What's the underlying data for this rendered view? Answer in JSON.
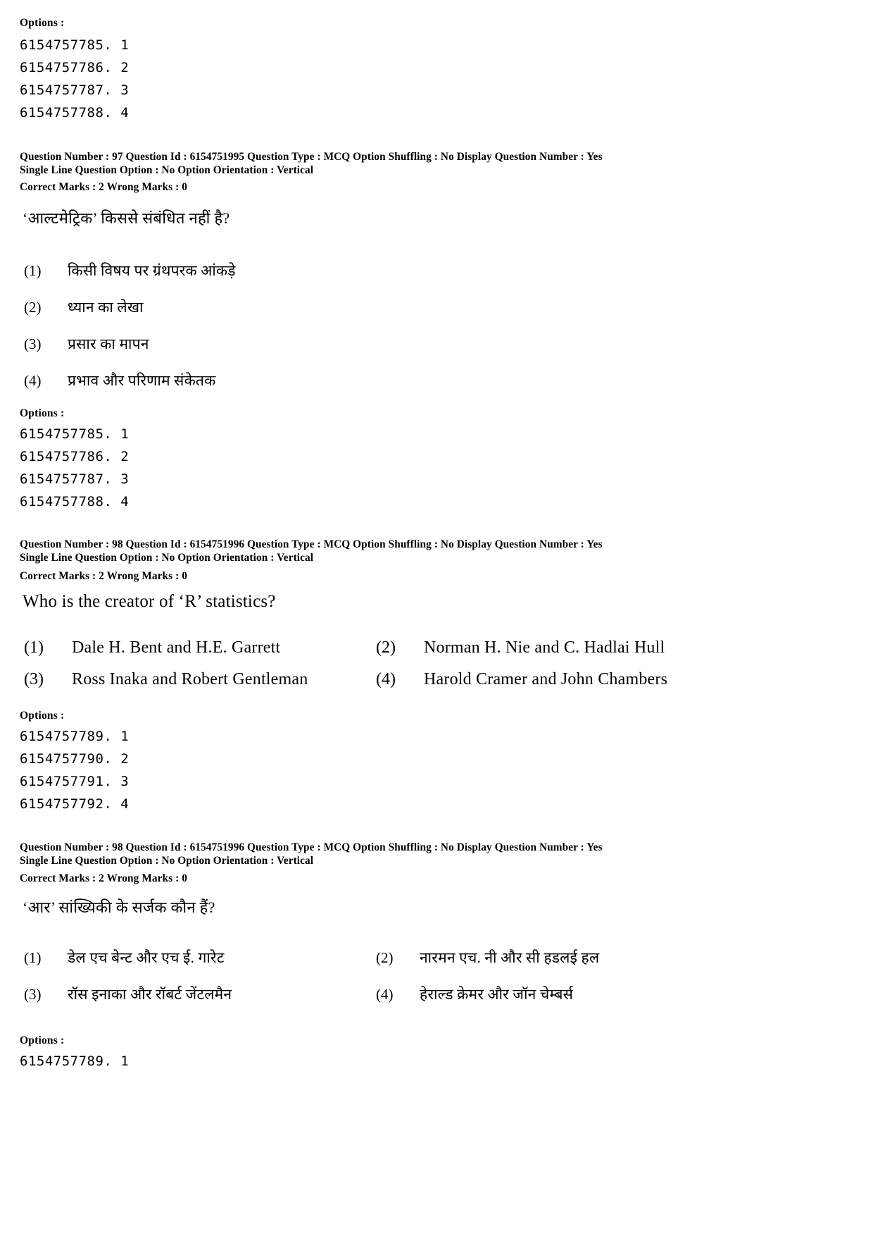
{
  "document": {
    "type": "exam-answer-key-sheet",
    "language_pairs": "English / Hindi"
  },
  "options_label": "Options :",
  "top_option_ids": [
    "6154757785. 1",
    "6154757786. 2",
    "6154757787. 3",
    "6154757788. 4"
  ],
  "questions": [
    {
      "id": "q97-hindi",
      "meta": {
        "line1": "Question Number : 97  Question Id : 6154751995  Question Type : MCQ  Option Shuffling : No  Display Question Number : Yes",
        "line2": "Single Line Question Option : No  Option Orientation : Vertical",
        "line3": "Correct Marks : 2  Wrong Marks : 0",
        "question_number": "97",
        "question_id": "6154751995",
        "question_type": "MCQ",
        "option_shuffling": "No",
        "display_question_number": "Yes",
        "single_line_question_option": "No",
        "option_orientation": "Vertical",
        "correct_marks": "2",
        "wrong_marks": "0"
      },
      "text": "‘आल्टमेट्रिक’ किससे संबंधित नहीं है?",
      "layout": "vertical",
      "options": [
        {
          "num": "(1)",
          "text": "किसी विषय पर ग्रंथपरक आंकड़े"
        },
        {
          "num": "(2)",
          "text": "ध्यान का लेखा"
        },
        {
          "num": "(3)",
          "text": "प्रसार का मापन"
        },
        {
          "num": "(4)",
          "text": "प्रभाव और परिणाम संकेतक"
        }
      ],
      "option_ids": [
        "6154757785. 1",
        "6154757786. 2",
        "6154757787. 3",
        "6154757788. 4"
      ]
    },
    {
      "id": "q98-english",
      "meta": {
        "line1": "Question Number : 98  Question Id : 6154751996  Question Type : MCQ  Option Shuffling : No  Display Question Number : Yes",
        "line2": "Single Line Question Option : No  Option Orientation : Vertical",
        "line3": "Correct Marks : 2  Wrong Marks : 0",
        "question_number": "98",
        "question_id": "6154751996",
        "question_type": "MCQ",
        "option_shuffling": "No",
        "display_question_number": "Yes",
        "single_line_question_option": "No",
        "option_orientation": "Vertical",
        "correct_marks": "2",
        "wrong_marks": "0"
      },
      "text": "Who is the creator of ‘R’ statistics?",
      "layout": "two-column",
      "options": [
        {
          "num": "(1)",
          "text": "Dale H. Bent and H.E. Garrett"
        },
        {
          "num": "(2)",
          "text": "Norman H. Nie and C. Hadlai Hull"
        },
        {
          "num": "(3)",
          "text": "Ross Inaka and Robert Gentleman"
        },
        {
          "num": "(4)",
          "text": "Harold Cramer and John Chambers"
        }
      ],
      "option_ids": [
        "6154757789. 1",
        "6154757790. 2",
        "6154757791. 3",
        "6154757792. 4"
      ]
    },
    {
      "id": "q98-hindi",
      "meta": {
        "line1": "Question Number : 98  Question Id : 6154751996  Question Type : MCQ  Option Shuffling : No  Display Question Number : Yes",
        "line2": "Single Line Question Option : No  Option Orientation : Vertical",
        "line3": "Correct Marks : 2  Wrong Marks : 0",
        "question_number": "98",
        "question_id": "6154751996",
        "question_type": "MCQ",
        "option_shuffling": "No",
        "display_question_number": "Yes",
        "single_line_question_option": "No",
        "option_orientation": "Vertical",
        "correct_marks": "2",
        "wrong_marks": "0"
      },
      "text": "‘आर’ सांख्यिकी के सर्जक कौन हैं?",
      "layout": "two-column",
      "options": [
        {
          "num": "(1)",
          "text": "डेल एच बेन्ट और एच ई. गारेट"
        },
        {
          "num": "(2)",
          "text": "नारमन एच. नी और सी हडलई हल"
        },
        {
          "num": "(3)",
          "text": "रॉस इनाका और रॉबर्ट जेंटलमैन"
        },
        {
          "num": "(4)",
          "text": "हेराल्ड क्रेमर और जॉन चेम्बर्स"
        }
      ],
      "option_ids": [
        "6154757789. 1"
      ]
    }
  ],
  "colors": {
    "background": "#ffffff",
    "text": "#000000"
  }
}
